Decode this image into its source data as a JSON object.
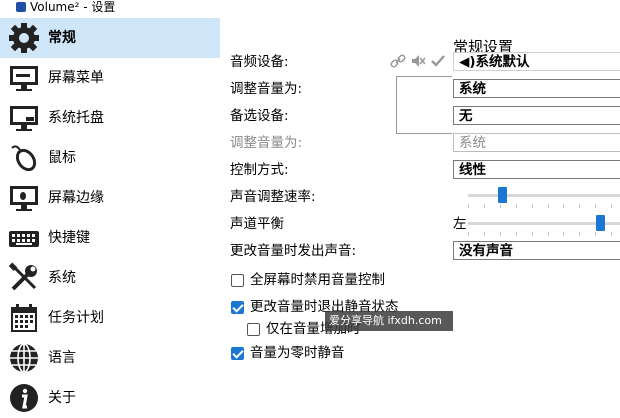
{
  "window": {
    "title": "Volume² - 设置"
  },
  "sidebar": {
    "items": [
      {
        "label": "常规",
        "icon": "gear-icon",
        "active": true
      },
      {
        "label": "屏幕菜单",
        "icon": "monitor-icon"
      },
      {
        "label": "系统托盘",
        "icon": "tray-icon"
      },
      {
        "label": "鼠标",
        "icon": "mouse-icon"
      },
      {
        "label": "屏幕边缘",
        "icon": "screen-edge-icon"
      },
      {
        "label": "快捷键",
        "icon": "keyboard-icon"
      },
      {
        "label": "系统",
        "icon": "tools-icon"
      },
      {
        "label": "任务计划",
        "icon": "calendar-icon"
      },
      {
        "label": "语言",
        "icon": "globe-icon"
      },
      {
        "label": "关于",
        "icon": "info-icon"
      }
    ]
  },
  "main": {
    "title": "常规设置",
    "audio_device_label": "音频设备:",
    "audio_device_value": "◀)系统默认",
    "adjust_volume_label": "调整音量为:",
    "adjust_volume_value": "系统",
    "alt_device_label": "备选设备:",
    "alt_device_value": "无",
    "alt_adjust_label": "调整音量为:",
    "alt_adjust_value": "系统",
    "control_mode_label": "控制方式:",
    "control_mode_value": "线性",
    "speed_label": "声音调整速率:",
    "speed_value": 0.2,
    "balance_label": "声道平衡",
    "balance_left": "左",
    "balance_value": 0.85,
    "sound_label": "更改音量时发出声音:",
    "sound_value": "没有声音",
    "checks": [
      {
        "label": "全屏幕时禁用音量控制",
        "checked": false
      },
      {
        "label": "更改音量时退出静音状态",
        "checked": true
      },
      {
        "label": "仅在音量增加时",
        "checked": false
      },
      {
        "label": "音量为零时静音",
        "checked": true
      }
    ]
  },
  "watermark": "爱分享导航 ifxdh.com",
  "colors": {
    "accent": "#1a77d2",
    "active_bg": "#cfe6f8"
  }
}
